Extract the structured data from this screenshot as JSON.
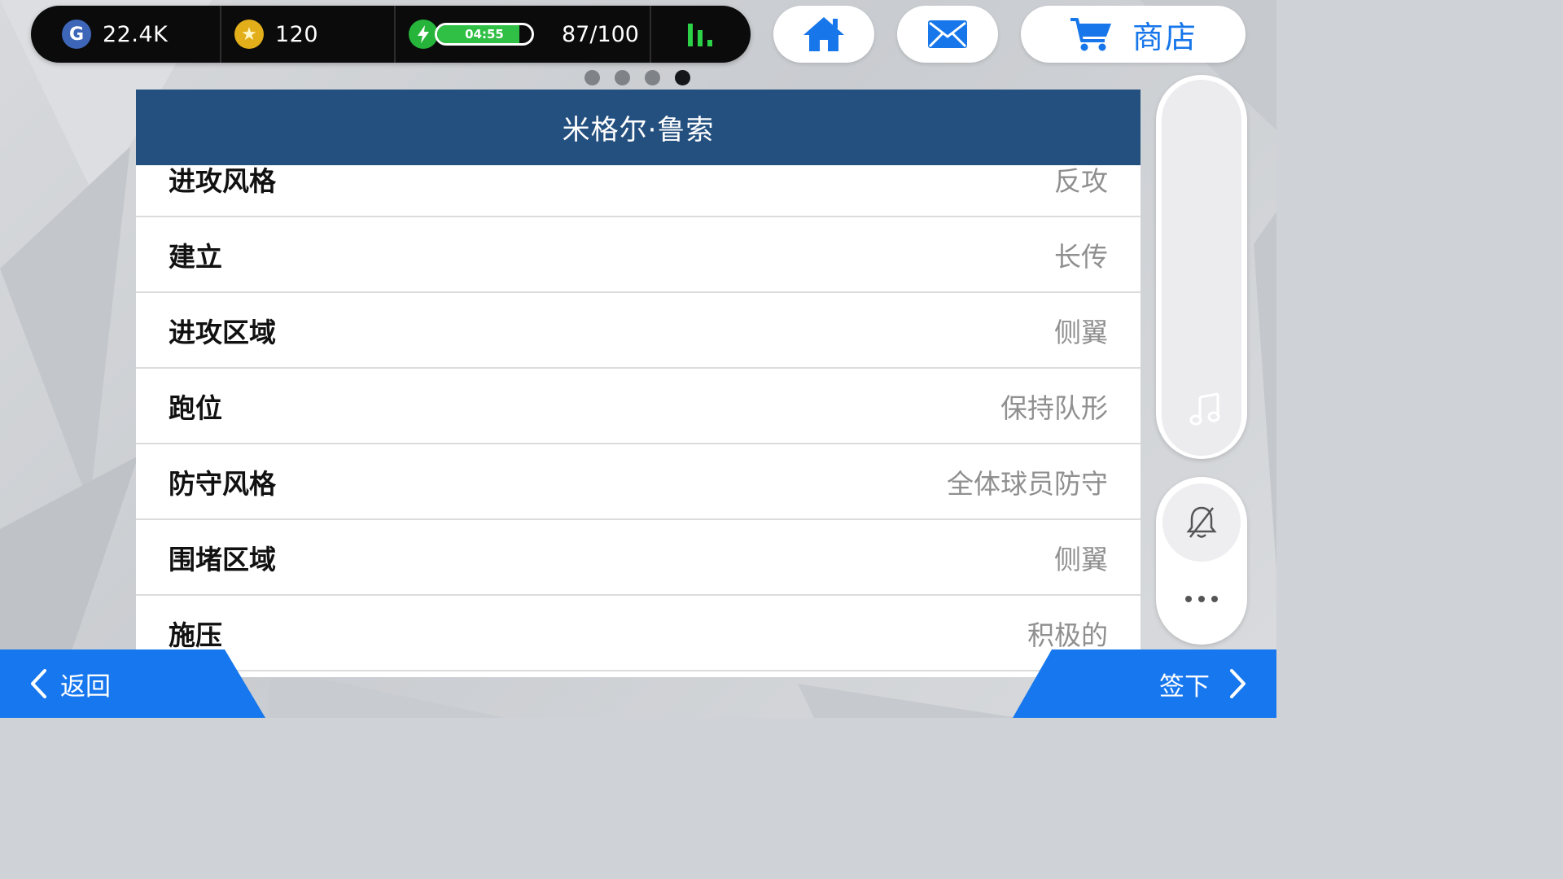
{
  "status_bar": {
    "g_value": "22.4K",
    "coin_value": "120",
    "energy_timer": "04:55",
    "energy_count": "87/100",
    "energy_level": 0.87
  },
  "nav": {
    "shop_label": "商店"
  },
  "pager": {
    "total": 4,
    "current": 4
  },
  "panel": {
    "title": "米格尔·鲁索",
    "rows": [
      {
        "label": "进攻风格",
        "value": "反攻"
      },
      {
        "label": "建立",
        "value": "长传"
      },
      {
        "label": "进攻区域",
        "value": "侧翼"
      },
      {
        "label": "跑位",
        "value": "保持队形"
      },
      {
        "label": "防守风格",
        "value": "全体球员防守"
      },
      {
        "label": "围堵区域",
        "value": "侧翼"
      },
      {
        "label": "施压",
        "value": "积极的"
      }
    ]
  },
  "footer": {
    "back_label": "返回",
    "sign_label": "签下"
  },
  "colors": {
    "accent": "#1777ee",
    "header": "#24507f",
    "energy": "#30c045"
  }
}
